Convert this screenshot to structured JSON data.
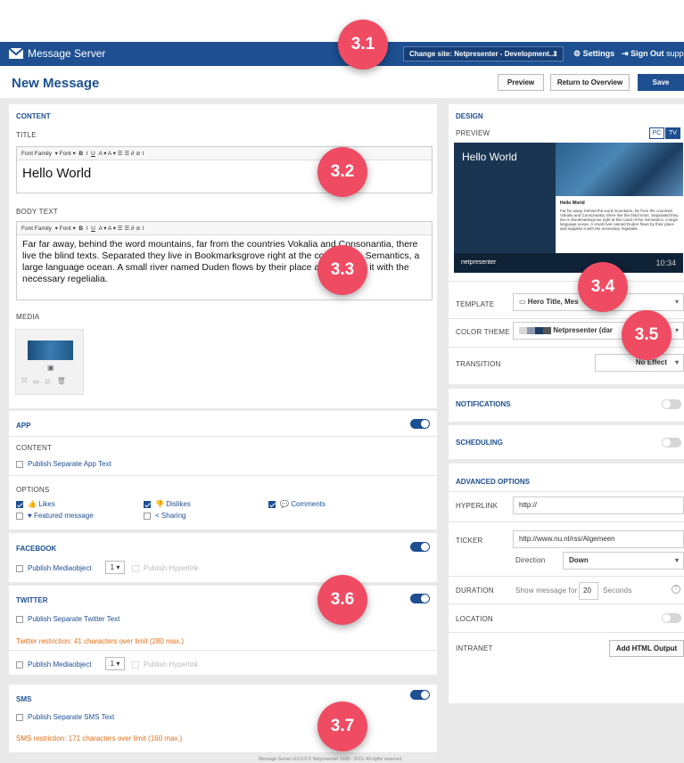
{
  "app": {
    "name": "Message Server",
    "site": "Change site: Netpresenter - Development...",
    "site_caret": "⇕",
    "settings": "Settings",
    "signout": "Sign Out",
    "support": "suppo"
  },
  "page": {
    "title": "New Message",
    "preview": "Preview",
    "return": "Return to Overview",
    "save": "Save"
  },
  "content": {
    "title": "CONTENT",
    "title_label": "TITLE",
    "title_value": "Hello World",
    "body_label": "BODY TEXT",
    "body_value": "Far far away, behind the word mountains, far from the countries Vokalia and Consonantia, there live the blind texts. Separated they live in Bookmarksgrove right at the coast of the Semantics, a large language ocean. A small river named Duden flows by their place and supplies it with the necessary regelialia.",
    "media_label": "MEDIA"
  },
  "editor": {
    "font_family": "Font Family",
    "font": "Font ▾",
    "b": "B",
    "i": "I",
    "u": "U",
    "rest": "A ▾  A ▾  ☰ ☰  ∂ ⊘  I"
  },
  "app_section": {
    "title": "APP",
    "content_label": "CONTENT",
    "publish_app": "Publish Separate App Text",
    "options_label": "OPTIONS",
    "likes": "Likes",
    "dislikes": "Dislikes",
    "comments": "Comments",
    "featured": "Featured message",
    "sharing": "Sharing"
  },
  "facebook": {
    "title": "FACEBOOK",
    "mediaobject": "Publish Mediaobject",
    "count": "1 ▾",
    "hyperlink": "Publish Hyperlink"
  },
  "twitter": {
    "title": "TWITTER",
    "publish": "Publish Separate Twitter Text",
    "warning": "Twitter restriction: 41 characters over limit (280 max.)",
    "mediaobject": "Publish Mediaobject",
    "count": "1 ▾",
    "hyperlink": "Publish Hyperlink"
  },
  "sms": {
    "title": "SMS",
    "publish": "Publish Separate SMS Text",
    "warning": "SMS restriction: 171 characters over limit (160 max.)"
  },
  "design": {
    "title": "DESIGN",
    "preview_label": "PREVIEW",
    "pc": "PC",
    "tv": "TV",
    "pv_title": "Hello World",
    "pv_card_title": "Hello World",
    "pv_card_text": "Far far away, behind the word mountains, far from the countries Vokalia and Consonantia, there live the blind texts. Separated they live in Bookmarksgrove right at the coast of the Semantics, a large language ocean. A small river named Duden flows by their place and supplies it with the necessary regelialia.",
    "pv_brand": "netpresenter",
    "pv_time": "10:34",
    "template_label": "TEMPLATE",
    "template_value": "Hero Title, Mes",
    "theme_label": "COLOR THEME",
    "theme_value": "Netpresenter (dar",
    "transition_label": "TRANSITION",
    "transition_value": "No Effect"
  },
  "notifications": {
    "title": "NOTIFICATIONS"
  },
  "scheduling": {
    "title": "SCHEDULING"
  },
  "advanced": {
    "title": "ADVANCED OPTIONS",
    "hyperlink_label": "HYPERLINK",
    "hyperlink_value": "http://",
    "ticker_label": "TICKER",
    "ticker_value": "http://www.nu.nl/rss/Algemeen",
    "direction_label": "Direction",
    "direction_value": "Down",
    "duration_label": "DURATION",
    "duration_prefix": "Show message for",
    "duration_value": "20",
    "duration_suffix": "Seconds",
    "location_label": "LOCATION",
    "intranet_label": "INTRANET",
    "intranet_button": "Add HTML Output"
  },
  "badges": {
    "b31": "3.1",
    "b32": "3.2",
    "b33": "3.3",
    "b34": "3.4",
    "b35": "3.5",
    "b36": "3.6",
    "b37": "3.7"
  },
  "footer": "Message Server v10.0.0 © Netpresenter 1998 - 2019. All rights reserved.",
  "colors": {
    "brand": "#1d4f91",
    "warning": "#e0701a",
    "badge": "#ef4c63"
  }
}
